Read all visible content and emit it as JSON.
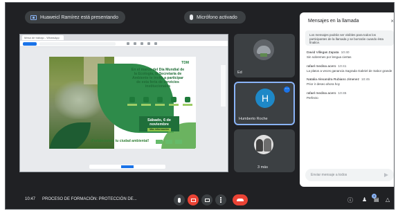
{
  "top": {
    "presenting_text": "Huaweicl Ramírez está presentando",
    "speaking_text": "Micrófono activado"
  },
  "flyer": {
    "browser_tab": "Mesa de trabajo - WhatsApp",
    "headline": "En el marco del Día Mundial de la Ecología, la Secretaría de Ambiente te invita a participar de esta feria de servicios institucionales",
    "date": "Sábado, 6 de noviembre",
    "date_sub": "Más información",
    "footer": "¡Fortalecemos tu ciudad ambiental!",
    "logo": "TDM"
  },
  "participants": [
    {
      "name": "Ed"
    },
    {
      "name": "Humberto Roche",
      "initial": "H"
    },
    {
      "name": "3 más"
    }
  ],
  "chat": {
    "title": "Mensajes en la llamada",
    "close_icon": "×",
    "note": "Los mensajes podrán ser visibles para todos los participantes de la llamada y se borrarán cuando ésta finalice.",
    "messages": [
      {
        "author": "David Villegas Zapata",
        "time": "10:40",
        "text": "Sin sobremes por lengua ciertas"
      },
      {
        "author": "rafael medina acero",
        "time": "10:41",
        "text": "La platos a veces ganancia Sagrada Gabriel de Sabor grande"
      },
      {
        "author": "Natalia Alexandra Rubiano Jimenez",
        "time": "10:45",
        "text": "Prior ir deseo ahora hoy"
      },
      {
        "author": "rafael medina acero",
        "time": "10:45",
        "text": "Perfecto"
      }
    ],
    "input_placeholder": "Enviar mensaje a todos"
  },
  "bottom": {
    "time": "10:47",
    "title": "PROCESO DE FORMACIÓN: PROTECCIÓN DE...",
    "people_count": "3"
  }
}
